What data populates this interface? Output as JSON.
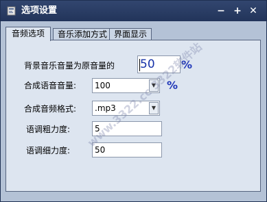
{
  "window": {
    "title": "选项设置",
    "controls": {
      "minimize": "−",
      "maximize": "+",
      "close": "✕"
    }
  },
  "tabs": [
    {
      "label": "音频选项",
      "active": true
    },
    {
      "label": "音乐添加方式",
      "active": false
    },
    {
      "label": "界面显示",
      "active": false
    }
  ],
  "form": {
    "bg_volume": {
      "label": "背景音乐音量为原音量的",
      "value": "50",
      "unit": "%"
    },
    "tts_volume": {
      "label": "合成语音音量:",
      "value": "100",
      "unit": "%"
    },
    "audio_format": {
      "label": "合成音频格式:",
      "value": ".mp3"
    },
    "coarse": {
      "label": "语调粗力度:",
      "value": "5"
    },
    "fine": {
      "label": "语调细力度:",
      "value": "50"
    }
  },
  "watermark": {
    "text": "www.3322.cc 3322软件站"
  },
  "colors": {
    "titlebar": "#283c64",
    "accent": "#1f36b8",
    "panel": "#dde5f0",
    "window": "#b4c2d6"
  }
}
